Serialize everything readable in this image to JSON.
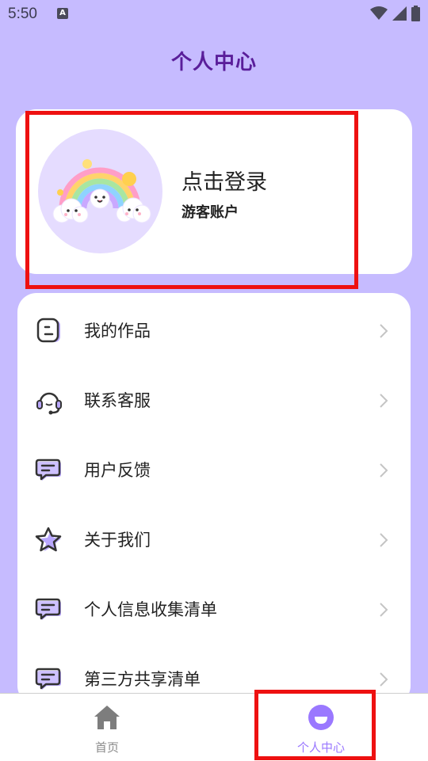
{
  "status_bar": {
    "time": "5:50",
    "indicator_letter": "A"
  },
  "header": {
    "title": "个人中心"
  },
  "profile": {
    "login_prompt": "点击登录",
    "account_type": "游客账户"
  },
  "menu": {
    "items": [
      {
        "label": "我的作品",
        "icon": "document-icon"
      },
      {
        "label": "联系客服",
        "icon": "headset-icon"
      },
      {
        "label": "用户反馈",
        "icon": "chat-icon"
      },
      {
        "label": "关于我们",
        "icon": "star-icon"
      },
      {
        "label": "个人信息收集清单",
        "icon": "chat-icon"
      },
      {
        "label": "第三方共享清单",
        "icon": "chat-icon"
      }
    ]
  },
  "tabs": {
    "home_label": "首页",
    "me_label": "个人中心"
  },
  "colors": {
    "background": "#c6bbff",
    "title": "#5a1e9a",
    "accent": "#9a78ff",
    "highlight": "#ee1111"
  }
}
